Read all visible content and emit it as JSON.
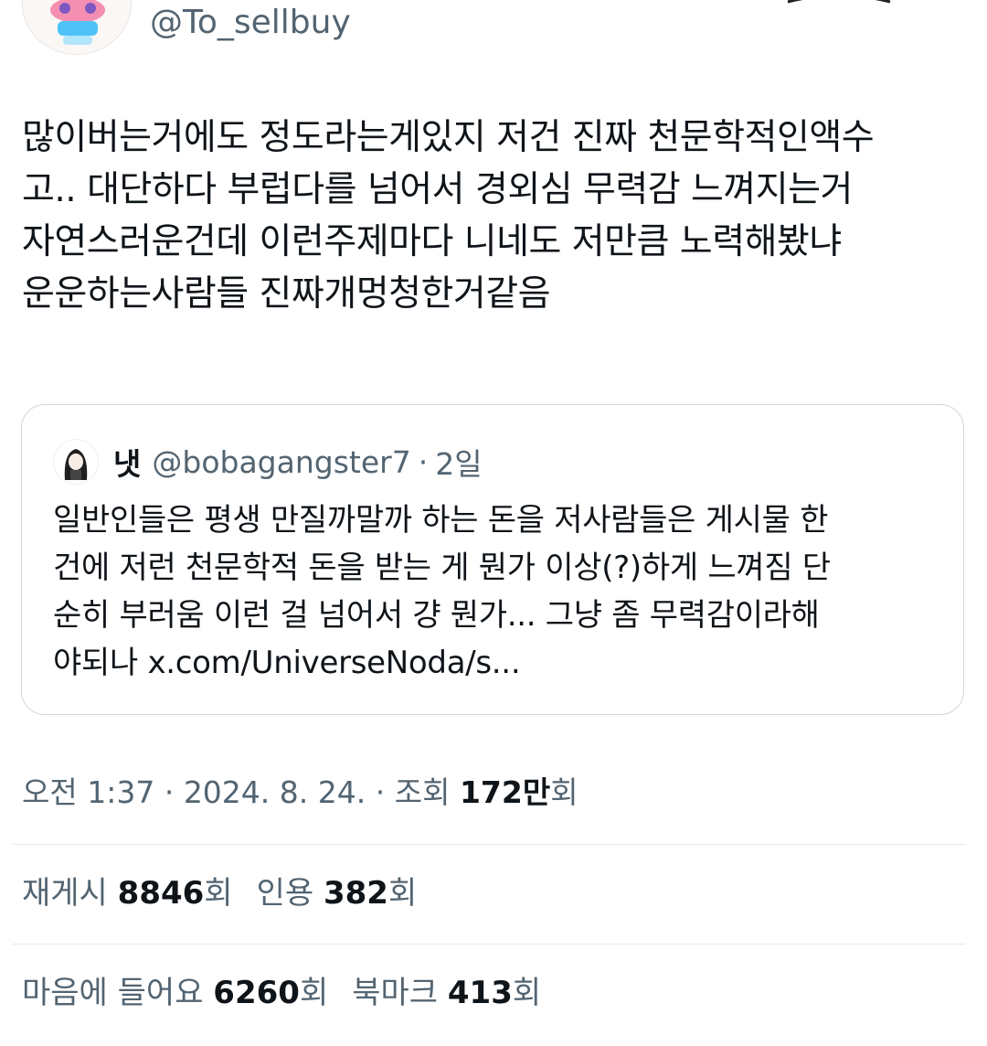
{
  "author": {
    "handle": "@To_sellbuy",
    "avatar_icon": "pink-character-avatar-icon"
  },
  "tweet": {
    "text": "많이버는거에도 정도라는게있지 저건 진짜 천문학적인액수\n고.. 대단하다 부럽다를 넘어서 경외심 무력감 느껴지는거\n자연스러운건데 이런주제마다 니네도 저만큼 노력해봤냐\n운운하는사람들 진짜개멍청한거같음"
  },
  "quote": {
    "avatar_icon": "girl-character-avatar-icon",
    "name": "냇",
    "handle": "@bobagangster7",
    "separator": "·",
    "time": "2일",
    "text": "일반인들은 평생 만질까말까 하는 돈을 저사람들은 게시물 한\n건에 저런 천문학적 돈을 받는 게 뭔가 이상(?)하게 느껴짐 단\n순히 부러움 이런 걸 넘어서 걍 뭔가... 그냥 좀 무력감이라해\n야되나 x.com/UniverseNoda/s..."
  },
  "meta": {
    "time": "오전 1:37",
    "sep1": " · ",
    "date": "2024. 8. 24.",
    "sep2": " · ",
    "views_label": "조회 ",
    "views_value": "172만",
    "views_suffix": "회"
  },
  "stats": {
    "reposts_label": "재게시 ",
    "reposts_value": "8846",
    "reposts_suffix": "회",
    "quotes_label": "인용 ",
    "quotes_value": "382",
    "quotes_suffix": "회",
    "likes_label": "마음에 들어요 ",
    "likes_value": "6260",
    "likes_suffix": "회",
    "bookmarks_label": "북마크 ",
    "bookmarks_value": "413",
    "bookmarks_suffix": "회"
  },
  "colors": {
    "text_primary": "#0f1419",
    "text_secondary": "#536471",
    "border": "#cfd9de",
    "divider": "#e1e8ed"
  }
}
